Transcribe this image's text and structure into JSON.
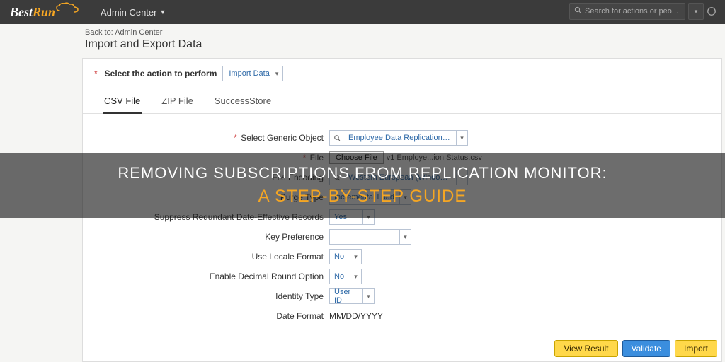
{
  "brand": {
    "a": "Best",
    "b": "Run"
  },
  "topnav": {
    "admin_label": "Admin Center",
    "search_placeholder": "Search for actions or peo..."
  },
  "breadcrumb": "Back to: Admin Center",
  "page_title": "Import and Export Data",
  "action": {
    "label": "Select the action to perform",
    "value": "Import Data"
  },
  "tabs": [
    {
      "label": "CSV File",
      "active": true
    },
    {
      "label": "ZIP File",
      "active": false
    },
    {
      "label": "SuccessStore",
      "active": false
    }
  ],
  "form": {
    "generic_object": {
      "label": "Select Generic Object",
      "value": "Employee Data Replication Stat..."
    },
    "file": {
      "label": "File",
      "button": "Choose File",
      "name": "v1 Employe...ion Status.csv"
    },
    "encoding": {
      "label": "File Encoding",
      "value": "Western European (Windows/ISO)"
    },
    "purge": {
      "label": "Purge Type",
      "value": "Incremental Load"
    },
    "suppress": {
      "label": "Suppress Redundant Date-Effective Records",
      "value": "Yes"
    },
    "key_pref": {
      "label": "Key Preference",
      "value": ""
    },
    "locale": {
      "label": "Use Locale Format",
      "value": "No"
    },
    "decimal": {
      "label": "Enable Decimal Round Option",
      "value": "No"
    },
    "identity": {
      "label": "Identity Type",
      "value": "User ID"
    },
    "date_format": {
      "label": "Date Format",
      "value": "MM/DD/YYYY"
    }
  },
  "buttons": {
    "view_result": "View Result",
    "validate": "Validate",
    "import": "Import"
  },
  "overlay": {
    "line1": "Removing Subscriptions from Replication Monitor:",
    "line2": "A Step-by-Step Guide"
  }
}
